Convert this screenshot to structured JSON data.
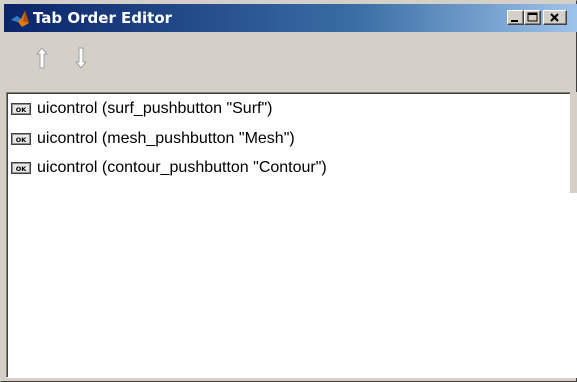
{
  "window": {
    "title": "Tab Order Editor",
    "app_icon": "matlab-logo-icon",
    "controls": {
      "minimize": "minimize-icon",
      "maximize": "maximize-icon",
      "close": "close-icon"
    }
  },
  "toolbar": {
    "buttons": [
      {
        "name": "move-up",
        "icon": "arrow-up-icon"
      },
      {
        "name": "move-down",
        "icon": "arrow-down-icon"
      }
    ]
  },
  "list": {
    "item_icon": "pushbutton-ok-icon",
    "items": [
      {
        "label": "uicontrol (surf_pushbutton \"Surf\")"
      },
      {
        "label": "uicontrol (mesh_pushbutton \"Mesh\")"
      },
      {
        "label": "uicontrol (contour_pushbutton \"Contour\")"
      }
    ]
  },
  "colors": {
    "title_gradient_start": "#0a246a",
    "title_gradient_end": "#a6caf0",
    "window_face": "#d4d0c8",
    "list_background": "#ffffff"
  }
}
